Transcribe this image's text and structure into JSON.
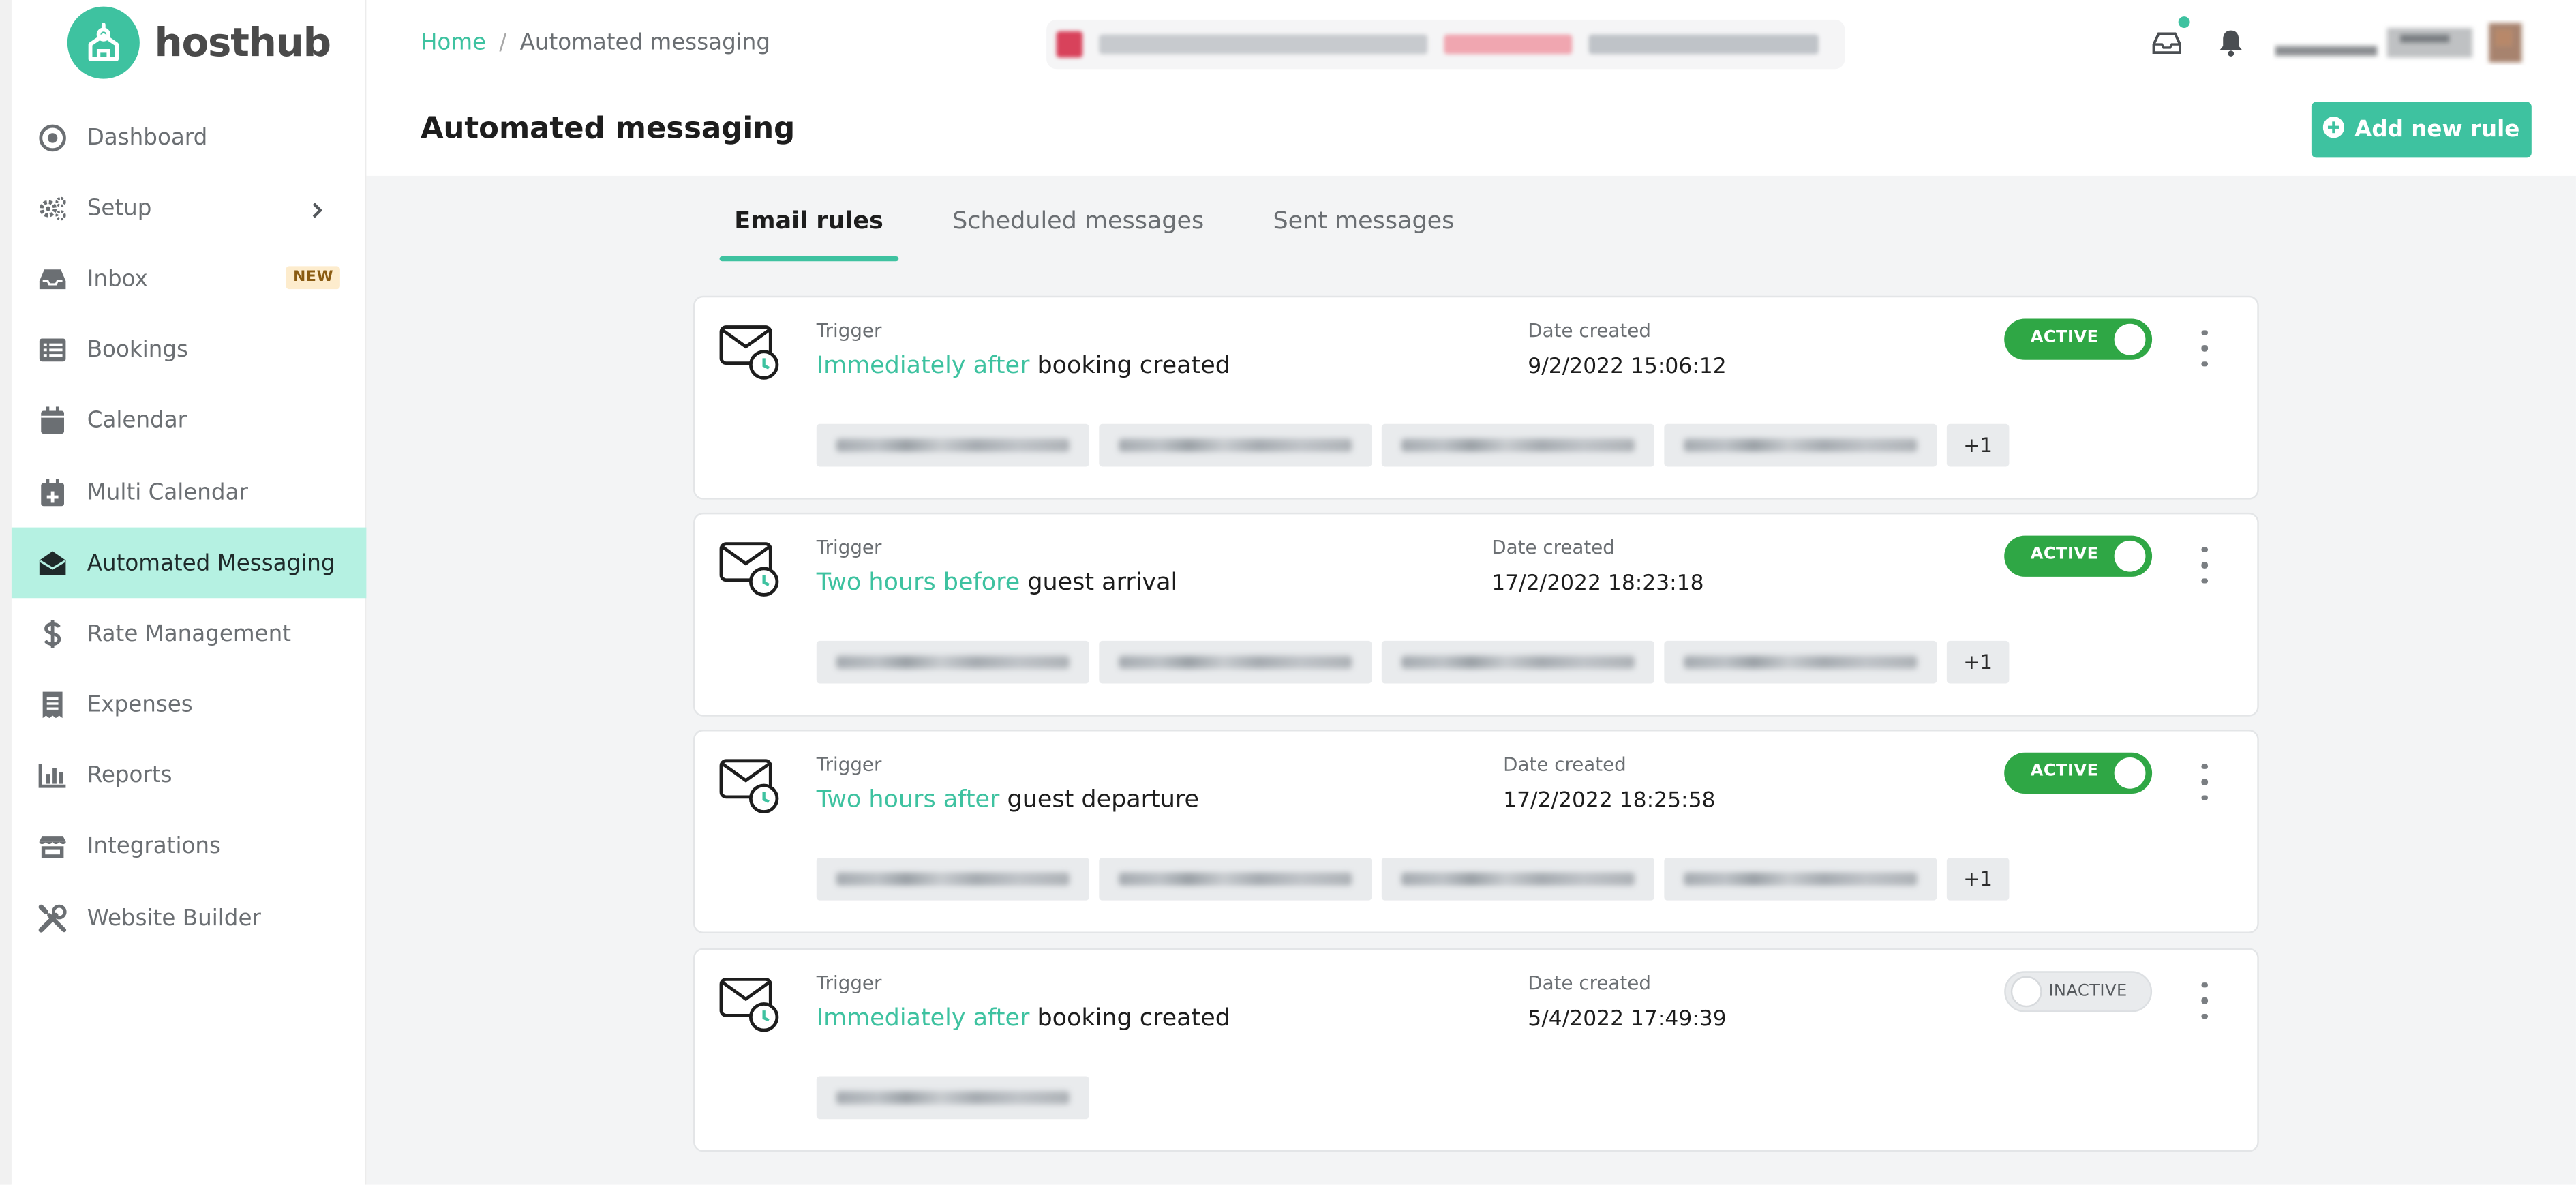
{
  "app": {
    "brand": "hosthub",
    "accent_color": "#3ec2a0",
    "toggle_on_color": "#2fa745"
  },
  "sidebar": {
    "items": [
      {
        "label": "Dashboard",
        "icon": "dashboard-icon"
      },
      {
        "label": "Setup",
        "icon": "gears-icon",
        "has_chevron": true
      },
      {
        "label": "Inbox",
        "icon": "inbox-icon",
        "badge": "NEW"
      },
      {
        "label": "Bookings",
        "icon": "list-icon"
      },
      {
        "label": "Calendar",
        "icon": "calendar-icon"
      },
      {
        "label": "Multi Calendar",
        "icon": "calendar-plus-icon"
      },
      {
        "label": "Automated Messaging",
        "icon": "envelope-open-icon",
        "active": true
      },
      {
        "label": "Rate Management",
        "icon": "dollar-icon"
      },
      {
        "label": "Expenses",
        "icon": "receipt-icon"
      },
      {
        "label": "Reports",
        "icon": "bar-chart-icon"
      },
      {
        "label": "Integrations",
        "icon": "store-icon"
      },
      {
        "label": "Website Builder",
        "icon": "tools-icon"
      }
    ]
  },
  "header": {
    "breadcrumb": {
      "home": "Home",
      "separator": "/",
      "current": "Automated messaging"
    },
    "page_title": "Automated messaging",
    "add_button_label": "Add new rule"
  },
  "tabs": [
    {
      "label": "Email rules",
      "active": true
    },
    {
      "label": "Scheduled messages",
      "active": false
    },
    {
      "label": "Sent messages",
      "active": false
    }
  ],
  "rules": [
    {
      "trigger_label": "Trigger",
      "timing": "Immediately after",
      "event": "booking created",
      "date_label": "Date created",
      "date": "9/2/2022 15:06:12",
      "status": "ACTIVE",
      "active": true,
      "chip_count": 4,
      "more": "+1"
    },
    {
      "trigger_label": "Trigger",
      "timing": "Two hours before",
      "event": "guest arrival",
      "date_label": "Date created",
      "date": "17/2/2022 18:23:18",
      "status": "ACTIVE",
      "active": true,
      "chip_count": 4,
      "more": "+1"
    },
    {
      "trigger_label": "Trigger",
      "timing": "Two hours after",
      "event": "guest departure",
      "date_label": "Date created",
      "date": "17/2/2022 18:25:58",
      "status": "ACTIVE",
      "active": true,
      "chip_count": 4,
      "more": "+1"
    },
    {
      "trigger_label": "Trigger",
      "timing": "Immediately after",
      "event": "booking created",
      "date_label": "Date created",
      "date": "5/4/2022 17:49:39",
      "status": "INACTIVE",
      "active": false,
      "chip_count": 1,
      "more": ""
    }
  ]
}
